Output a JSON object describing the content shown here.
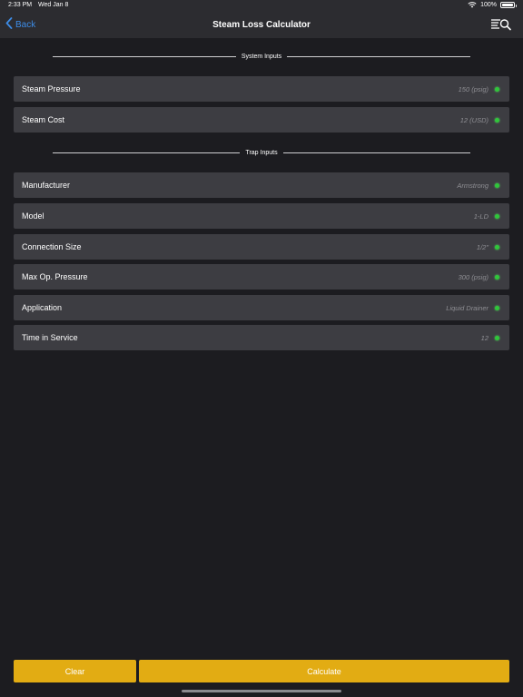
{
  "status_bar": {
    "time": "2:33 PM",
    "date": "Wed Jan 8",
    "battery": "100%"
  },
  "nav": {
    "back_label": "Back",
    "title": "Steam Loss Calculator",
    "icons": [
      "chevron-left-icon",
      "menu-search-icon"
    ]
  },
  "system_inputs": {
    "header": "System Inputs",
    "rows": [
      {
        "label": "Steam Pressure",
        "value": "150 (psig)"
      },
      {
        "label": "Steam Cost",
        "value": "12 (USD)"
      }
    ]
  },
  "trap_inputs": {
    "header": "Trap Inputs",
    "rows": [
      {
        "label": "Manufacturer",
        "value": "Armstrong"
      },
      {
        "label": "Model",
        "value": "1-LD"
      },
      {
        "label": "Connection Size",
        "value": "1/2\""
      },
      {
        "label": "Max Op. Pressure",
        "value": "300 (psig)"
      },
      {
        "label": "Application",
        "value": "Liquid Drainer"
      },
      {
        "label": "Time in Service",
        "value": "12"
      }
    ]
  },
  "buttons": {
    "clear_label": "Clear",
    "calculate_label": "Calculate"
  },
  "colors": {
    "background": "#1c1c20",
    "row": "#3d3d42",
    "accent": "#e2ac13",
    "link": "#3d8ce6",
    "status_ok": "#2fc63a"
  }
}
